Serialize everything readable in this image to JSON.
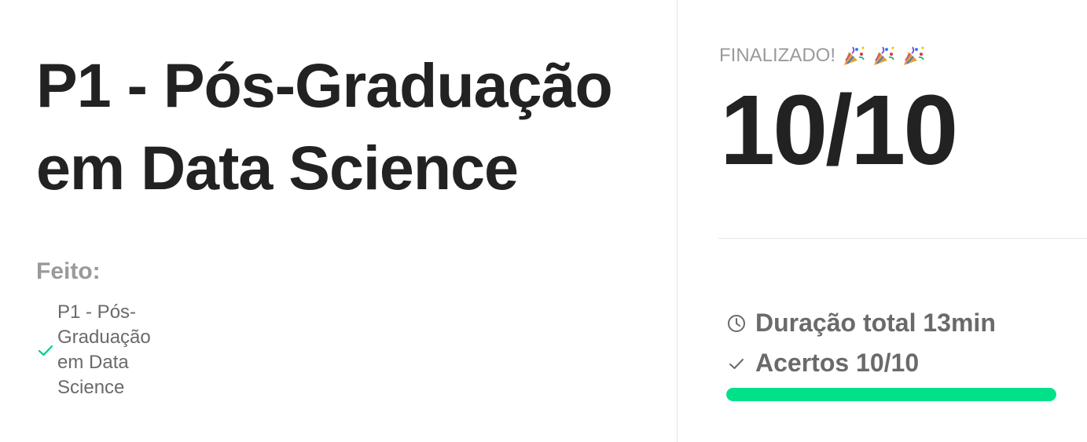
{
  "main": {
    "title": "P1 - Pós-Graduação em Data Science",
    "done_label": "Feito:",
    "done_items": [
      {
        "label": "P1 - Pós-Graduação em Data Science",
        "icon": "check-icon"
      }
    ]
  },
  "result": {
    "status_text": "FINALIZADO!",
    "status_icons": [
      "party-popper-icon",
      "party-popper-icon",
      "party-popper-icon"
    ],
    "score": "10/10",
    "duration_icon": "clock-icon",
    "duration_text": "Duração total 13min",
    "hits_icon": "check-icon",
    "hits_text": "Acertos 10/10",
    "progress_fraction": 1.0
  },
  "colors": {
    "accent_green": "#00e18a",
    "title_text": "#222222",
    "muted_text": "#9a9a9a",
    "stat_text": "#6a6a6a"
  }
}
